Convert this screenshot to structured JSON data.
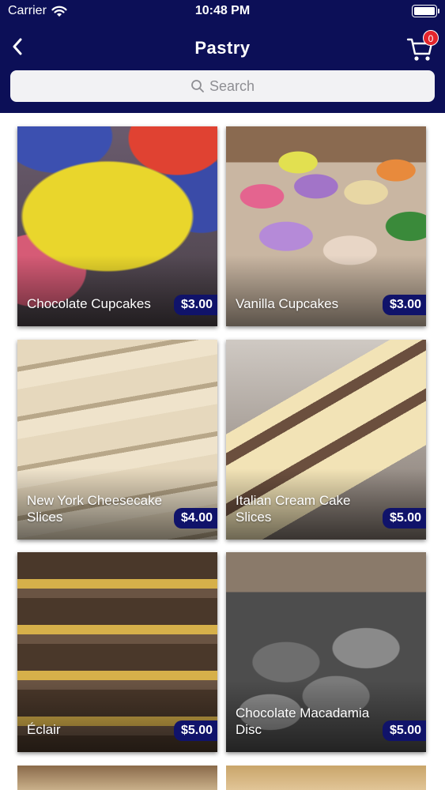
{
  "status_bar": {
    "carrier": "Carrier",
    "time": "10:48 PM"
  },
  "nav": {
    "title": "Pastry",
    "cart_count": "0"
  },
  "search": {
    "placeholder": "Search"
  },
  "products": [
    {
      "name": "Chocolate Cupcakes",
      "price": "$3.00"
    },
    {
      "name": "Vanilla Cupcakes",
      "price": "$3.00"
    },
    {
      "name": "New York Cheesecake Slices",
      "price": "$4.00"
    },
    {
      "name": "Italian Cream Cake Slices",
      "price": "$5.00"
    },
    {
      "name": "Éclair",
      "price": "$5.00"
    },
    {
      "name": "Chocolate Macadamia Disc",
      "price": "$5.00"
    }
  ],
  "colors": {
    "header": "#0c0f57",
    "price_badge": "#10136a",
    "cart_badge": "#e4252c"
  }
}
